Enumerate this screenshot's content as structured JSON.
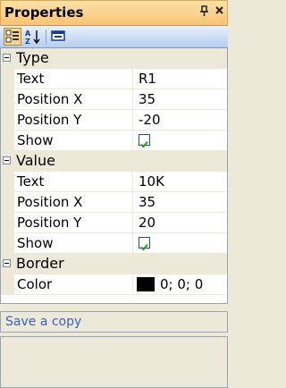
{
  "title": "Properties",
  "title_buttons": {
    "pin": "д",
    "close": "×"
  },
  "toolbar": {
    "buttons": [
      {
        "icon": "categorized-icon",
        "active": true
      },
      {
        "icon": "alphabetical-sort-icon",
        "active": false
      },
      {
        "icon": "property-pages-icon",
        "active": false
      }
    ]
  },
  "categories": [
    {
      "label": "Type",
      "properties": [
        {
          "name": "Text",
          "value": "R1"
        },
        {
          "name": "Position X",
          "value": "35"
        },
        {
          "name": "Position Y",
          "value": "-20"
        },
        {
          "name": "Show",
          "value": true
        }
      ]
    },
    {
      "label": "Value",
      "properties": [
        {
          "name": "Text",
          "value": "10K"
        },
        {
          "name": "Position X",
          "value": "35"
        },
        {
          "name": "Position Y",
          "value": "20"
        },
        {
          "name": "Show",
          "value": true
        }
      ]
    },
    {
      "label": "Border",
      "properties": [
        {
          "name": "Color",
          "value": "0; 0; 0",
          "swatch": "#000000"
        }
      ]
    }
  ],
  "commands": {
    "save_copy": "Save a copy"
  },
  "colors": {
    "title_bg": "#f8c373",
    "category_bg": "#ece9d8",
    "link": "#3b5fc4",
    "check": "#21a121"
  }
}
